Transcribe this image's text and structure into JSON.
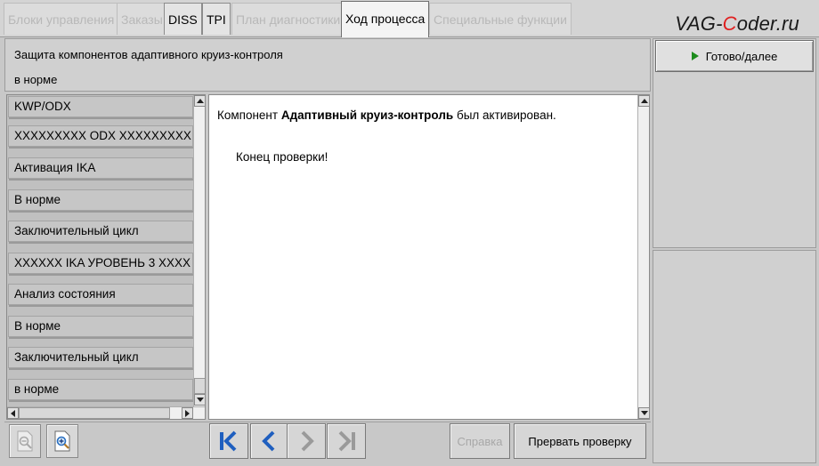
{
  "tabs": [
    {
      "label": "Блоки управления",
      "state": "disabled"
    },
    {
      "label": "Заказы",
      "state": "disabled"
    },
    {
      "label": "DISS",
      "state": "enabled"
    },
    {
      "label": "TPI",
      "state": "enabled"
    },
    {
      "label": "План диагностики",
      "state": "disabled"
    },
    {
      "label": "Ход процесса",
      "state": "active"
    },
    {
      "label": "Специальные функции",
      "state": "disabled"
    }
  ],
  "watermark": {
    "prefix": "VAG-",
    "highlight": "C",
    "suffix": "oder.ru"
  },
  "header": {
    "title": "Защита компонентов адаптивного круиз-контроля",
    "status": "в норме"
  },
  "done_button": {
    "label": "Готово/далее",
    "icon": "play-icon",
    "icon_color": "#1c8c1c"
  },
  "list_items": [
    "KWP/ODX",
    "XXXXXXXXX ODX XXXXXXXXX",
    "Активация IKA",
    "В норме",
    "Заключительный цикл",
    "XXXXXX IKA УРОВЕНЬ 3 XXXX",
    "Анализ состояния",
    "В норме",
    "Заключительный цикл",
    "в норме"
  ],
  "content": {
    "line1_prefix": "Компонент ",
    "line1_bold": "Адаптивный круиз-контроль",
    "line1_suffix": " был активирован.",
    "line2": "Конец проверки!"
  },
  "toolbar": {
    "zoom_out_icon": "zoom-out-icon",
    "zoom_in_icon": "zoom-in-icon",
    "first_icon": "skip-first-icon",
    "prev_icon": "chevron-left-icon",
    "next_icon": "chevron-right-icon",
    "last_icon": "skip-last-icon",
    "help_label": "Справка",
    "abort_label": "Прервать проверку"
  },
  "colors": {
    "nav_active": "#1f5fbf",
    "nav_disabled": "#9a9a9a",
    "watermark_accent": "#e02020"
  }
}
